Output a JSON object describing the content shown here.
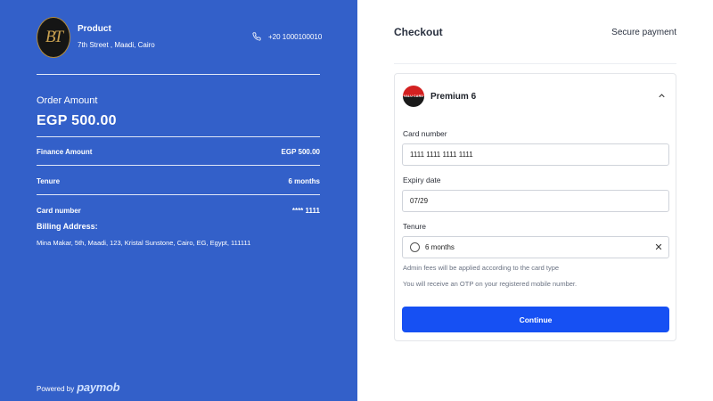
{
  "merchant": {
    "logo_text": "BT",
    "name": "Product",
    "address": "7th Street , Maadi, Cairo",
    "phone": "+20 1000100010"
  },
  "order": {
    "amount_label": "Order Amount",
    "amount": "EGP 500.00",
    "finance_label": "Finance Amount",
    "finance_value": "EGP 500.00",
    "tenure_label": "Tenure",
    "tenure_value": "6 months",
    "card_label": "Card number",
    "card_value": "**** 1111",
    "billing_label": "Billing Address:",
    "billing_address": "Mina Makar, 5th, Maadi, 123, Kristal Sunstone, Cairo, EG, Egypt, 111111"
  },
  "footer": {
    "powered_by": "Powered by",
    "brand": "paymob"
  },
  "checkout": {
    "title": "Checkout",
    "secure": "Secure payment",
    "card_brand_logo_text": "VALU CARD",
    "card_brand": "Premium 6",
    "card_number_label": "Card number",
    "card_number_value": "1111 1111 1111 1111",
    "expiry_label": "Expiry date",
    "expiry_value": "07/29",
    "tenure_label": "Tenure",
    "tenure_value": "6 months",
    "note_fees": "Admin fees will be applied according to the card type",
    "note_otp": "You will receive an OTP on your registered mobile number.",
    "continue_label": "Continue"
  },
  "colors": {
    "left_panel": "#3360c9",
    "continue_button": "#1650f3"
  },
  "icons": {
    "phone": "phone-icon",
    "chevron": "chevron-up-icon",
    "clear": "close-icon"
  }
}
